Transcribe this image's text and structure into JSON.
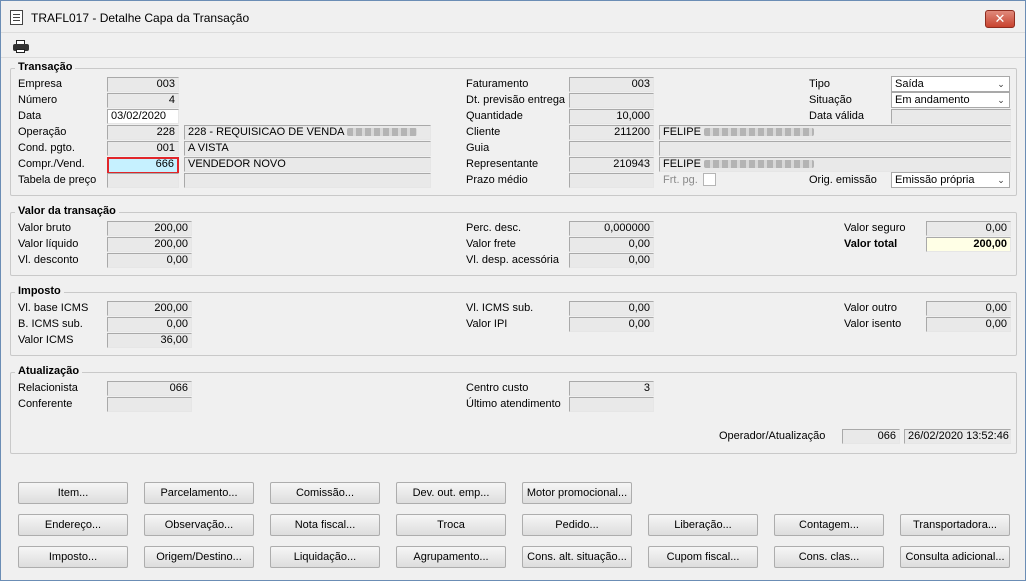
{
  "window": {
    "title": "TRAFL017 - Detalhe Capa da Transação",
    "close": "✕"
  },
  "transacao": {
    "title": "Transação",
    "empresa": {
      "label": "Empresa",
      "value": "003"
    },
    "numero": {
      "label": "Número",
      "value": "4"
    },
    "data": {
      "label": "Data",
      "value": "03/02/2020"
    },
    "operacao": {
      "label": "Operação",
      "value": "228",
      "desc": "228 - REQUISICAO DE VENDA"
    },
    "cond_pgto": {
      "label": "Cond. pgto.",
      "value": "001",
      "desc": "A VISTA"
    },
    "compr_vend": {
      "label": "Compr./Vend.",
      "value": "666",
      "desc": "VENDEDOR NOVO"
    },
    "tabela_preco": {
      "label": "Tabela de preço",
      "value": ""
    },
    "faturamento": {
      "label": "Faturamento",
      "value": "003"
    },
    "dt_previsao": {
      "label": "Dt. previsão entrega",
      "value": ""
    },
    "quantidade": {
      "label": "Quantidade",
      "value": "10,000"
    },
    "cliente": {
      "label": "Cliente",
      "value": "211200",
      "desc": "FELIPE"
    },
    "guia": {
      "label": "Guia",
      "value": ""
    },
    "representante": {
      "label": "Representante",
      "value": "210943",
      "desc": "FELIPE"
    },
    "prazo_medio": {
      "label": "Prazo médio",
      "value": ""
    },
    "frt_pg": {
      "label": "Frt. pg."
    },
    "tipo": {
      "label": "Tipo",
      "value": "Saída"
    },
    "situacao": {
      "label": "Situação",
      "value": "Em andamento"
    },
    "data_valida": {
      "label": "Data válida",
      "value": ""
    },
    "orig_emissao": {
      "label": "Orig. emissão",
      "value": "Emissão própria"
    }
  },
  "valor": {
    "title": "Valor da transação",
    "bruto": {
      "label": "Valor bruto",
      "value": "200,00"
    },
    "liquido": {
      "label": "Valor líquido",
      "value": "200,00"
    },
    "desconto": {
      "label": "Vl. desconto",
      "value": "0,00"
    },
    "perc_desc": {
      "label": "Perc. desc.",
      "value": "0,000000"
    },
    "frete": {
      "label": "Valor frete",
      "value": "0,00"
    },
    "desp_acess": {
      "label": "Vl. desp. acessória",
      "value": "0,00"
    },
    "seguro": {
      "label": "Valor seguro",
      "value": "0,00"
    },
    "total": {
      "label": "Valor total",
      "value": "200,00"
    }
  },
  "imposto": {
    "title": "Imposto",
    "base_icms": {
      "label": "Vl. base ICMS",
      "value": "200,00"
    },
    "b_icms_sub": {
      "label": "B. ICMS sub.",
      "value": "0,00"
    },
    "valor_icms": {
      "label": "Valor ICMS",
      "value": "36,00"
    },
    "icms_sub": {
      "label": "Vl. ICMS sub.",
      "value": "0,00"
    },
    "ipi": {
      "label": "Valor IPI",
      "value": "0,00"
    },
    "outro": {
      "label": "Valor outro",
      "value": "0,00"
    },
    "isento": {
      "label": "Valor isento",
      "value": "0,00"
    }
  },
  "atualizacao": {
    "title": "Atualização",
    "relacionista": {
      "label": "Relacionista",
      "value": "066"
    },
    "conferente": {
      "label": "Conferente",
      "value": ""
    },
    "centro_custo": {
      "label": "Centro custo",
      "value": "3"
    },
    "ultimo_atend": {
      "label": "Último atendimento",
      "value": ""
    },
    "operador": {
      "label": "Operador/Atualização",
      "value": "066",
      "datetime": "26/02/2020 13:52:46"
    }
  },
  "buttons": {
    "item": "Item...",
    "parcelamento": "Parcelamento...",
    "comissao": "Comissão...",
    "dev_out_emp": "Dev. out. emp...",
    "motor_promocional": "Motor promocional...",
    "endereco": "Endereço...",
    "observacao": "Observação...",
    "nota_fiscal": "Nota fiscal...",
    "troca": "Troca",
    "pedido": "Pedido...",
    "liberacao": "Liberação...",
    "contagem": "Contagem...",
    "transportadora": "Transportadora...",
    "imposto": "Imposto...",
    "origem_destino": "Origem/Destino...",
    "liquidacao": "Liquidação...",
    "agrupamento": "Agrupamento...",
    "cons_alt_situacao": "Cons. alt. situação...",
    "cupom_fiscal": "Cupom fiscal...",
    "cons_clas": "Cons. clas...",
    "consulta_adicional": "Consulta adicional..."
  }
}
